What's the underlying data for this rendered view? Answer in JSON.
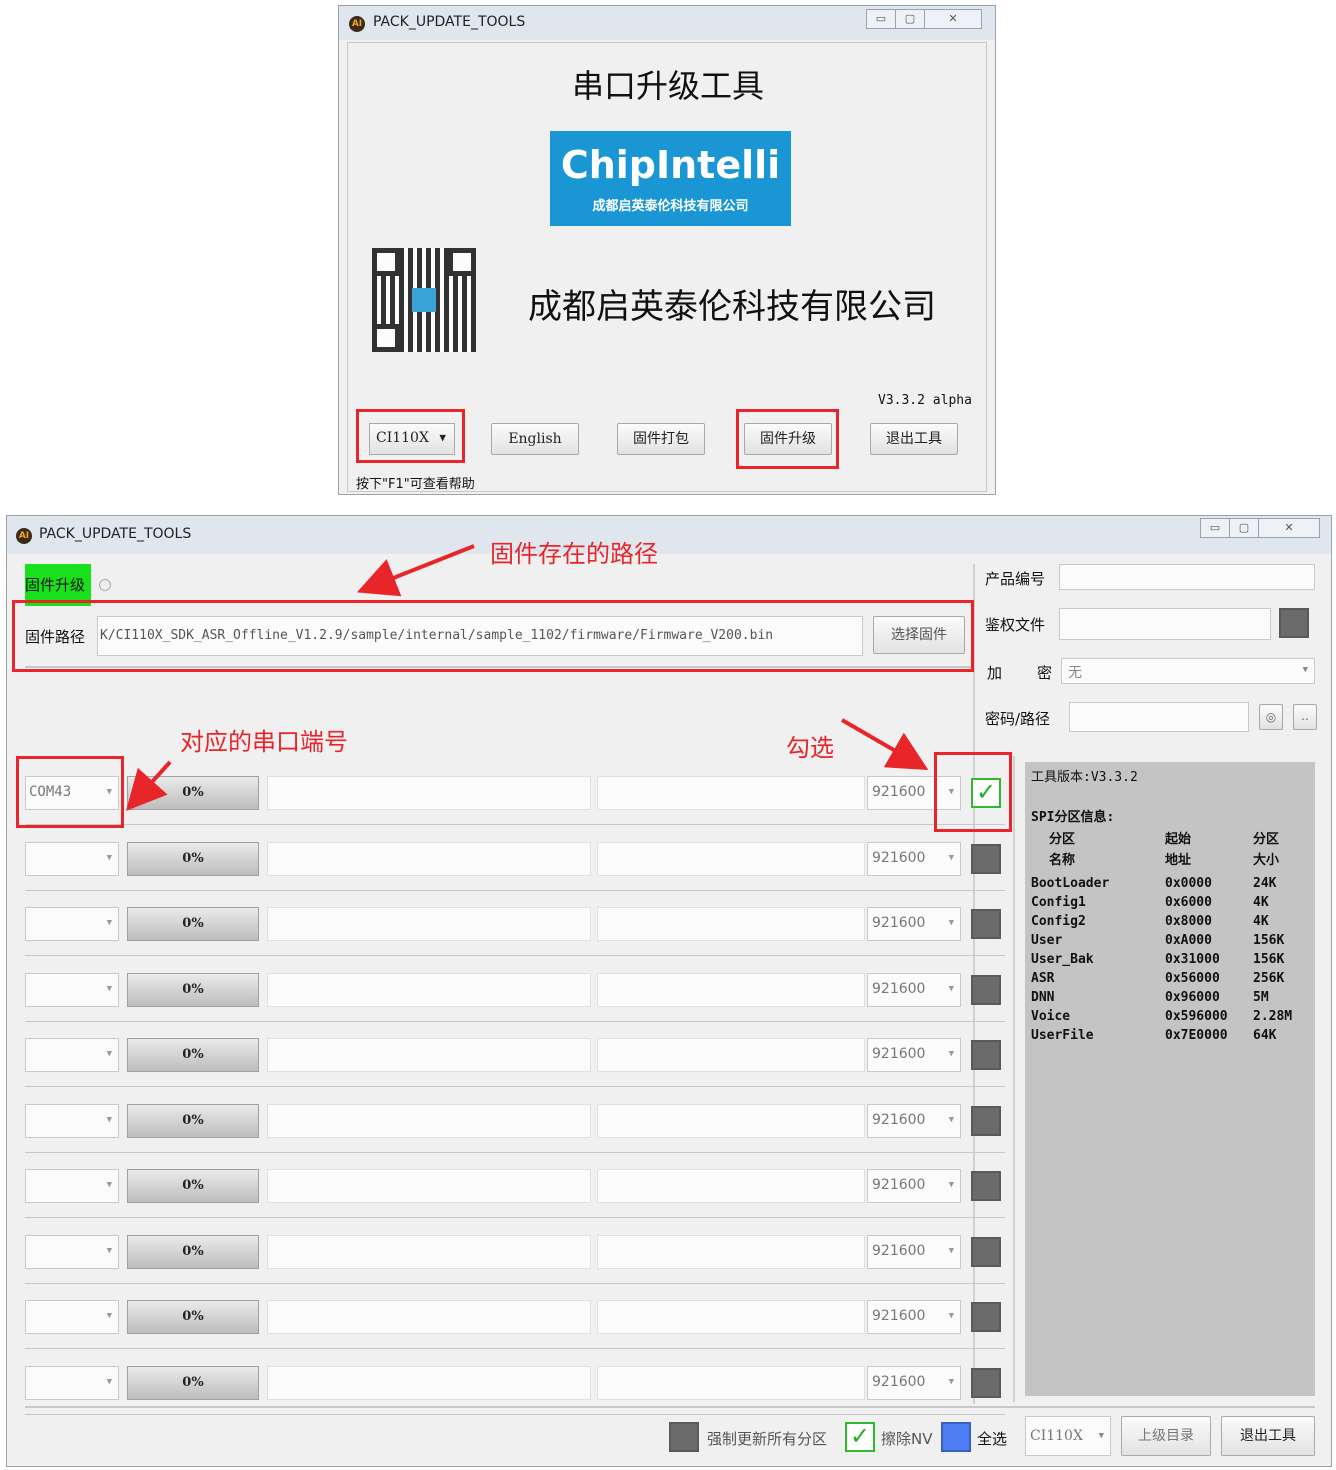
{
  "top_window": {
    "title": "PACK_UPDATE_TOOLS",
    "heading": "串口升级工具",
    "logo_text": "ChipIntelli",
    "logo_subtext": "成都启英泰伦科技有限公司",
    "company_name": "成都启英泰伦科技有限公司",
    "version": "V3.3.2 alpha",
    "chip_select": "CI110X",
    "buttons": [
      "English",
      "固件打包",
      "固件升级",
      "退出工具"
    ],
    "help_hint": "按下\"F1\"可查看帮助"
  },
  "bottom_window": {
    "title": "PACK_UPDATE_TOOLS",
    "tab_label": "固件升级",
    "firmware_path_label": "固件路径",
    "firmware_path_value": "K/CI110X_SDK_ASR_Offline_V1.2.9/sample/internal/sample_1102/firmware/Firmware_V200.bin",
    "select_firmware_button": "选择固件",
    "annotations": {
      "path": "固件存在的路径",
      "port": "对应的串口端号",
      "check": "勾选"
    },
    "rows": [
      {
        "port": "COM43",
        "progress": "0%",
        "baud": "921600",
        "checked": true
      },
      {
        "port": "",
        "progress": "0%",
        "baud": "921600",
        "checked": false
      },
      {
        "port": "",
        "progress": "0%",
        "baud": "921600",
        "checked": false
      },
      {
        "port": "",
        "progress": "0%",
        "baud": "921600",
        "checked": false
      },
      {
        "port": "",
        "progress": "0%",
        "baud": "921600",
        "checked": false
      },
      {
        "port": "",
        "progress": "0%",
        "baud": "921600",
        "checked": false
      },
      {
        "port": "",
        "progress": "0%",
        "baud": "921600",
        "checked": false
      },
      {
        "port": "",
        "progress": "0%",
        "baud": "921600",
        "checked": false
      },
      {
        "port": "",
        "progress": "0%",
        "baud": "921600",
        "checked": false
      },
      {
        "port": "",
        "progress": "0%",
        "baud": "921600",
        "checked": false
      }
    ],
    "right_panel": {
      "product_label": "产品编号",
      "product_value": "",
      "auth_label": "鉴权文件",
      "encrypt_label_1": "加",
      "encrypt_label_2": "密",
      "encrypt_value": "无",
      "password_label": "密码/路径",
      "dots_button": "..",
      "tool_version": "工具版本:V3.3.2",
      "spi_title": "SPI分区信息:",
      "spi_headers": [
        [
          "分区",
          "名称"
        ],
        [
          "起始",
          "地址"
        ],
        [
          "分区",
          "大小"
        ]
      ],
      "spi_rows": [
        [
          "BootLoader",
          "0x0000",
          "24K"
        ],
        [
          "Config1",
          "0x6000",
          "4K"
        ],
        [
          "Config2",
          "0x8000",
          "4K"
        ],
        [
          "User",
          "0xA000",
          "156K"
        ],
        [
          "User_Bak",
          "0x31000",
          "156K"
        ],
        [
          "ASR",
          "0x56000",
          "256K"
        ],
        [
          "DNN",
          "0x96000",
          "5M"
        ],
        [
          "Voice",
          "0x596000",
          "2.28M"
        ],
        [
          "UserFile",
          "0x7E0000",
          "64K"
        ]
      ]
    },
    "footer": {
      "force_update_label": "强制更新所有分区",
      "erase_nv_label": "擦除NV",
      "select_all_label": "全选",
      "chip_select": "CI110X",
      "parent_dir_button": "上级目录",
      "exit_button": "退出工具"
    }
  }
}
